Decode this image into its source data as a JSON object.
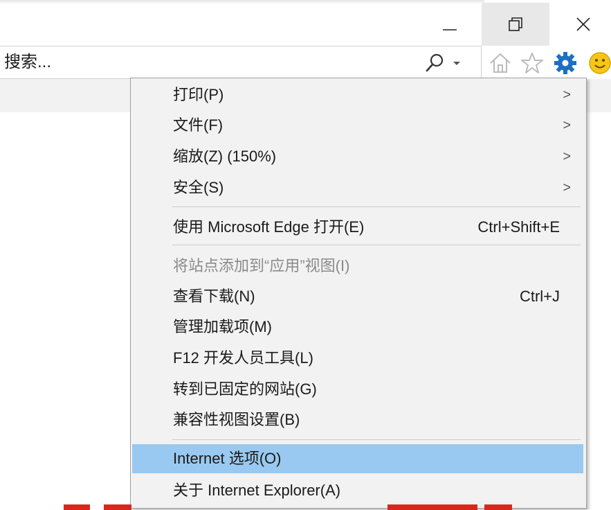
{
  "window": {
    "minimize_icon": "minimize-icon",
    "restore_icon": "restore-icon",
    "close_icon": "close-icon"
  },
  "address_bar": {
    "search_placeholder": "搜索...",
    "search_icon": "search-icon",
    "dropdown_icon": "chevron-down-icon"
  },
  "toolbar": {
    "icons": [
      "home-icon",
      "favorites-star-icon",
      "tools-gear-icon",
      "feedback-smiley-icon"
    ]
  },
  "tools_menu": {
    "items": [
      {
        "label": "打印(P)",
        "submenu": true
      },
      {
        "label": "文件(F)",
        "submenu": true
      },
      {
        "label": "缩放(Z) (150%)",
        "submenu": true
      },
      {
        "label": "安全(S)",
        "submenu": true
      },
      {
        "label": "使用 Microsoft Edge 打开(E)",
        "shortcut": "Ctrl+Shift+E"
      },
      {
        "label": "将站点添加到“应用”视图(I)",
        "disabled": true
      },
      {
        "label": "查看下载(N)",
        "shortcut": "Ctrl+J"
      },
      {
        "label": "管理加载项(M)"
      },
      {
        "label": "F12 开发人员工具(L)"
      },
      {
        "label": "转到已固定的网站(G)"
      },
      {
        "label": "兼容性视图设置(B)"
      },
      {
        "label": "Internet 选项(O)",
        "highlighted": true
      },
      {
        "label": "关于 Internet Explorer(A)"
      }
    ],
    "submenu_arrow": ">"
  },
  "colors": {
    "menu_background": "#f2f2f2",
    "highlight": "#99c9f0",
    "disabled_text": "#8a8a8a",
    "gear_blue": "#1e6fc2",
    "smiley_yellow": "#f5c518"
  }
}
